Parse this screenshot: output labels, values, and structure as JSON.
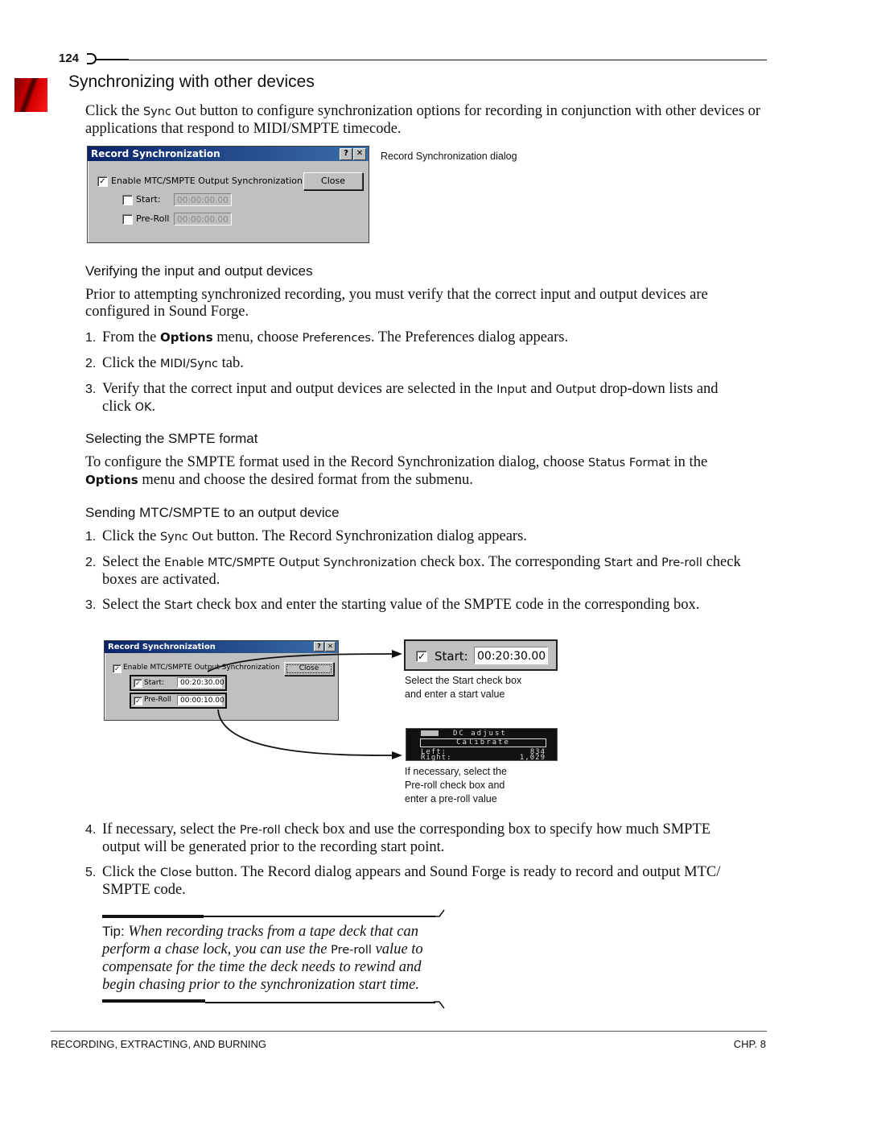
{
  "header": {
    "page_number": "124",
    "section_title": "Synchronizing with other devices"
  },
  "intro": {
    "t1": "Click the ",
    "ui1": "Sync Out",
    "t2": " button to configure synchronization options for recording in conjunction with other devices or applications that respond to MIDI/SMPTE timecode."
  },
  "dialog1": {
    "title": "Record Synchronization",
    "help_btn": "?",
    "close_x": "✕",
    "enable_label": "Enable MTC/SMPTE Output Synchronization",
    "enable_checked": "✓",
    "close_button": "Close",
    "start_label": "Start:",
    "start_value": "00:00:00.00",
    "preroll_label": "Pre-Roll",
    "preroll_value": "00:00:00.00",
    "caption": "Record Synchronization dialog"
  },
  "verify": {
    "heading": "Verifying the input and output devices",
    "intro": "Prior to attempting synchronized recording, you must verify that the correct input and output devices are configured in Sound Forge.",
    "steps": [
      {
        "num": "1.",
        "a": "From the ",
        "b_bold": "Options",
        "c": " menu, choose ",
        "d_ui": "Preferences",
        "e": ". The Preferences dialog appears."
      },
      {
        "num": "2.",
        "a": "Click the ",
        "b_ui": "MIDI/Sync",
        "c": " tab."
      },
      {
        "num": "3.",
        "a": "Verify that the correct input and output devices are selected in the ",
        "b_ui": "Input",
        "c": " and ",
        "d_ui": "Output",
        "e": " drop-down lists and",
        "f": "click ",
        "g_ui": "OK",
        "h": "."
      }
    ]
  },
  "smpte": {
    "heading": "Selecting the SMPTE format",
    "a": "To configure the SMPTE format used in the Record Synchronization dialog, choose ",
    "b_ui": "Status Format",
    "c": " in the",
    "d_bold": "Options",
    "e": " menu and choose the desired format from the submenu."
  },
  "sending": {
    "heading": "Sending MTC/SMPTE to an output device",
    "steps": [
      {
        "num": "1.",
        "a": "Click the ",
        "b_ui": "Sync Out",
        "c": " button. The Record Synchronization dialog appears."
      },
      {
        "num": "2.",
        "a": "Select the ",
        "b_ui": "Enable MTC/SMPTE Output Synchronization",
        "c": " check box. The corresponding ",
        "d_ui": "Start",
        "e": " and ",
        "f_ui": "Pre-roll",
        "g": " check",
        "h": "boxes are activated."
      },
      {
        "num": "3.",
        "a": "Select the ",
        "b_ui": "Start",
        "c": " check box and enter the starting value of the SMPTE code in the corresponding box."
      },
      {
        "num": "4.",
        "a": "If necessary, select the ",
        "b_ui": "Pre-roll",
        "c": " check box and use the corresponding box to specify how much SMPTE",
        "d": "output will be generated prior to the recording start point."
      },
      {
        "num": "5.",
        "a": "Click the ",
        "b_ui": "Close",
        "c": " button. The Record dialog appears and Sound Forge is ready to record and output MTC/",
        "d": "SMPTE code."
      }
    ]
  },
  "dialog2": {
    "title": "Record Synchronization",
    "help_btn": "?",
    "close_x": "✕",
    "enable_label": "Enable MTC/SMPTE Output Synchronization",
    "check": "✓",
    "close_button": "Close",
    "start_label": "Start:",
    "start_value": "00:20:30.00",
    "preroll_label": "Pre-Roll",
    "preroll_value": "00:00:10.00"
  },
  "callout_start": {
    "label": "Start:",
    "value": "00:20:30.00",
    "check": "✓",
    "caption_line1": "Select the Start check box",
    "caption_line2": "and enter a start value"
  },
  "callout_preroll": {
    "row1": "DC adjust",
    "row2": "Calibrate",
    "left_label": "Left:",
    "left_value": "834",
    "right_label": "Right:",
    "right_value": "1,029",
    "caption_line1": "If necessary, select the",
    "caption_line2": "Pre-roll check box and",
    "caption_line3": "enter a pre-roll value"
  },
  "tip": {
    "label": "Tip:",
    "a": " When recording tracks from a tape deck that can perform a chase lock, you can use the ",
    "b_ui": "Pre-roll",
    "c": " value to compensate for the time the deck needs to rewind and begin chasing prior to the synchronization start time."
  },
  "footer": {
    "left": "RECORDING, EXTRACTING, AND BURNING",
    "right": "CHP. 8"
  }
}
